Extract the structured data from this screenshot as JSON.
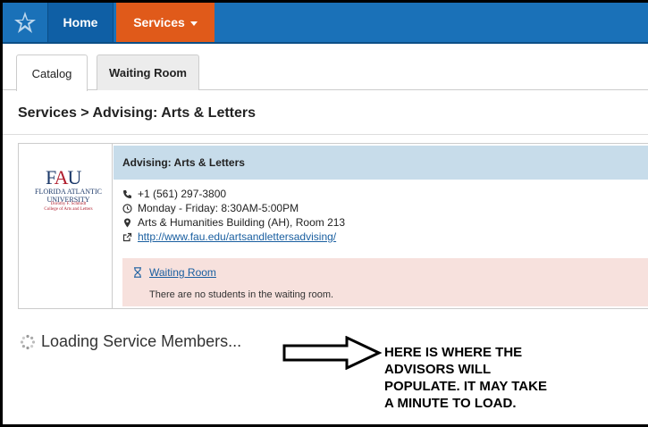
{
  "nav": {
    "home": "Home",
    "services": "Services"
  },
  "tabs": {
    "catalog": "Catalog",
    "waiting_room": "Waiting Room"
  },
  "breadcrumb": "Services > Advising: Arts & Letters",
  "logo": {
    "mark_f": "F",
    "mark_a": "A",
    "mark_u": "U",
    "line1": "FLORIDA ATLANTIC",
    "line1b": "UNIVERSITY",
    "line2": "Dorothy F. Schmidt",
    "line2b": "College of Arts and Letters"
  },
  "service": {
    "title": "Advising: Arts & Letters",
    "phone": "+1 (561) 297-3800",
    "hours": "Monday - Friday: 8:30AM-5:00PM",
    "location": "Arts & Humanities Building (AH), Room 213",
    "website": "http://www.fau.edu/artsandlettersadvising/"
  },
  "waiting": {
    "link": "Waiting Room",
    "message": "There are no students in the waiting room."
  },
  "loading": "Loading Service Members...",
  "annotation": {
    "line1": "HERE IS WHERE THE",
    "line2": "ADVISORS WILL",
    "line3": "POPULATE. IT MAY TAKE",
    "line4": "A MINUTE TO LOAD."
  },
  "colors": {
    "nav_blue": "#1a71b8",
    "services_orange": "#e05a1a",
    "header_blue": "#c7dcea",
    "waiting_pink": "#f7e1dd"
  }
}
